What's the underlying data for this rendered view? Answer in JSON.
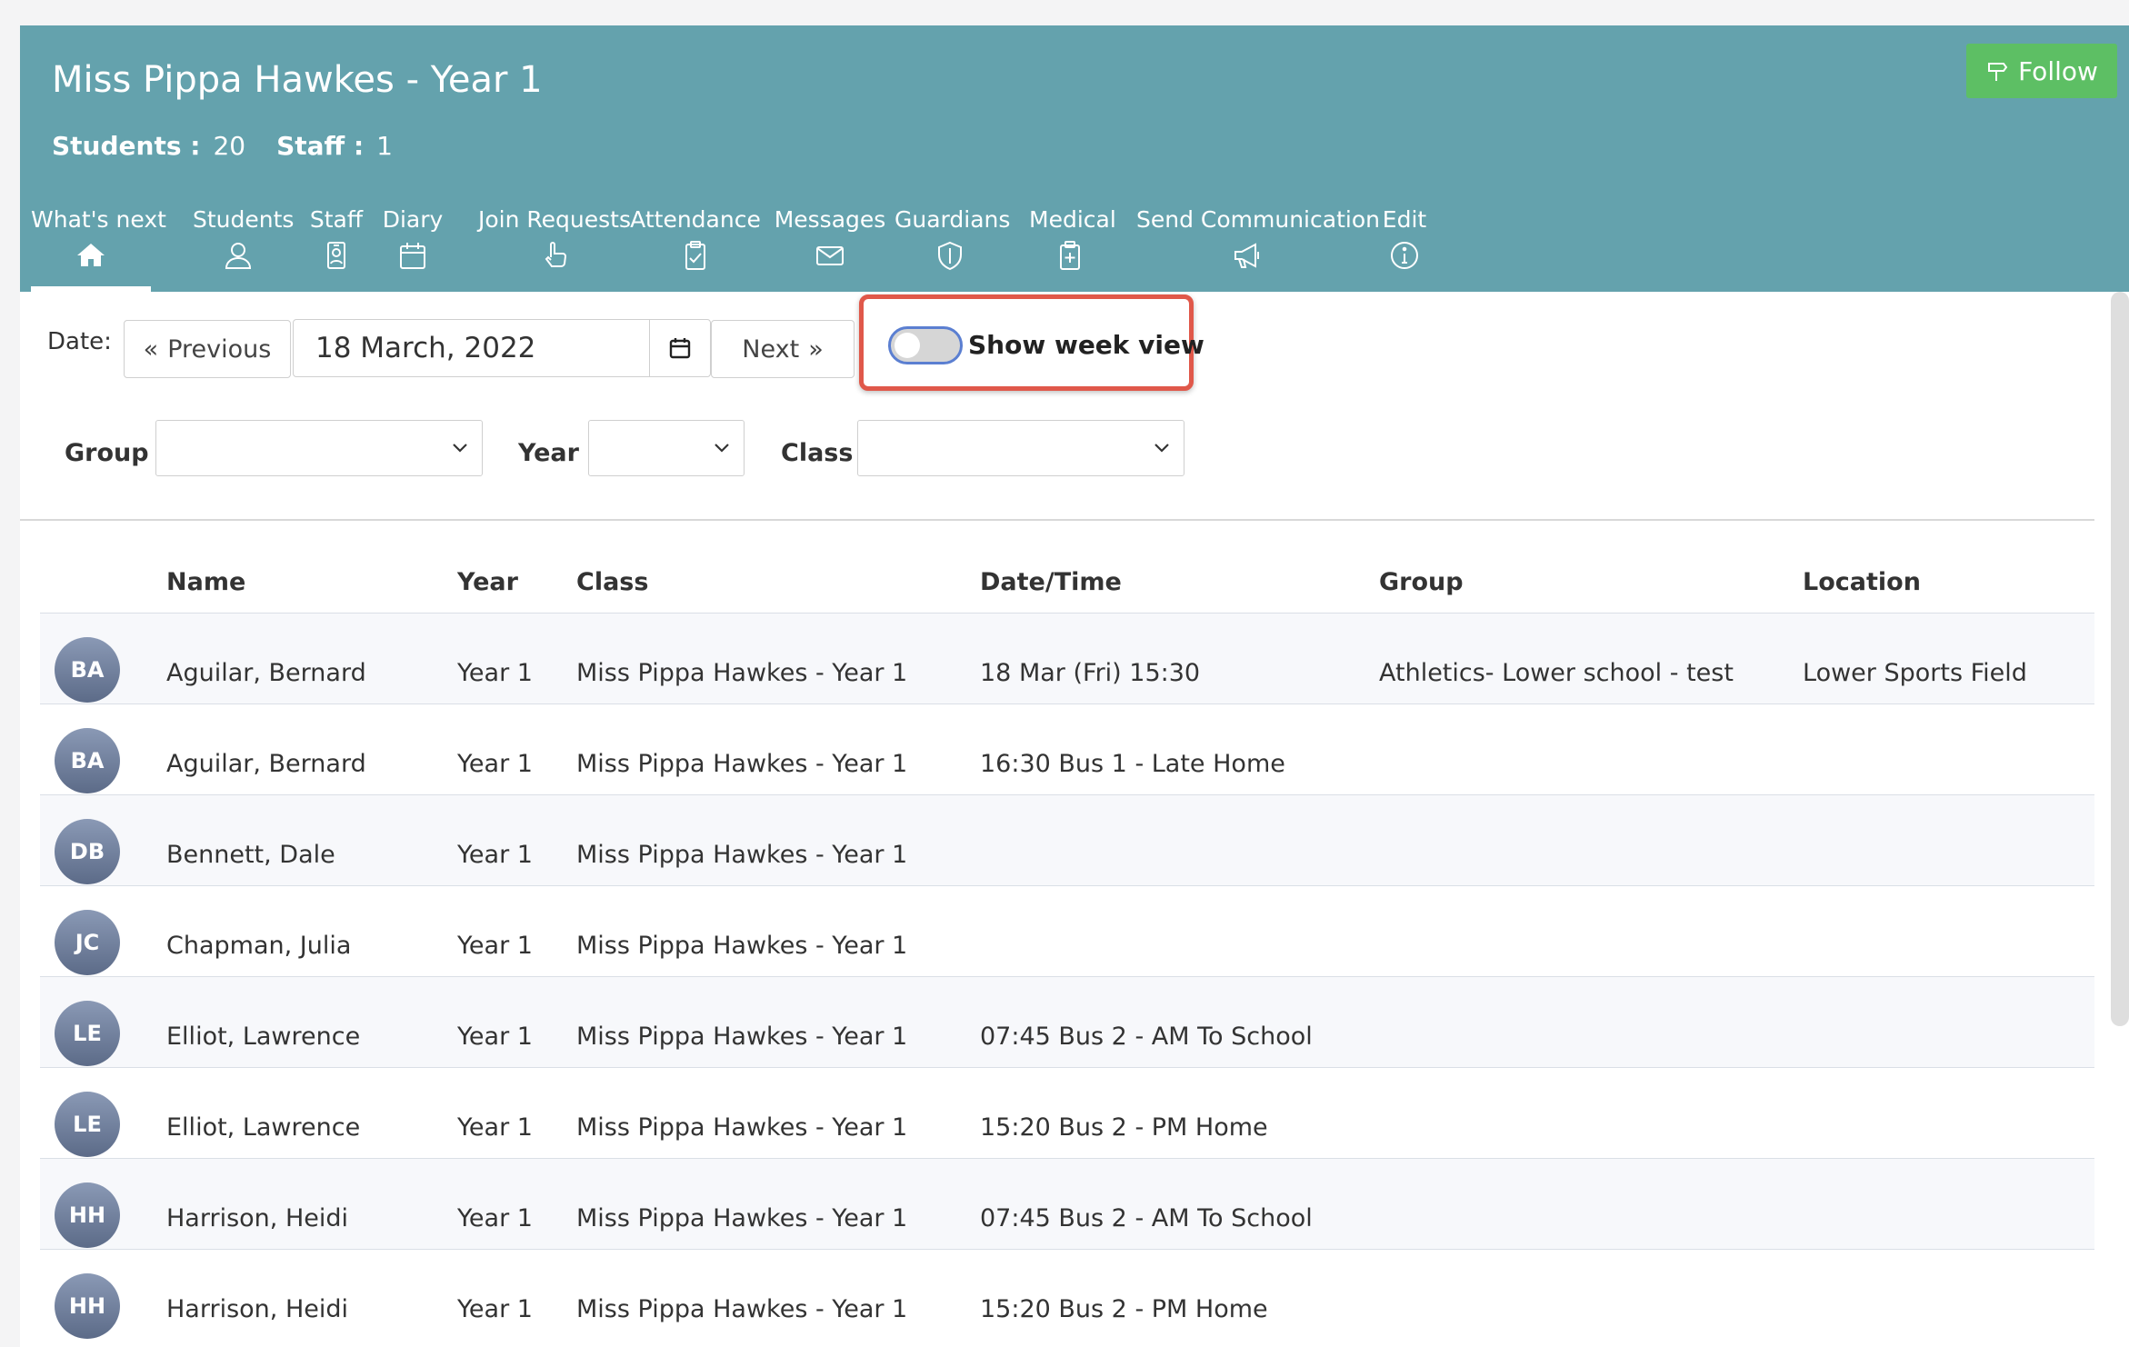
{
  "header": {
    "title": "Miss Pippa Hawkes - Year 1",
    "students_label": "Students :",
    "students_count": "20",
    "staff_label": "Staff :",
    "staff_count": "1",
    "follow_label": "Follow"
  },
  "nav": {
    "tabs": [
      {
        "label": "What's next",
        "icon": "home-icon"
      },
      {
        "label": "Students",
        "icon": "person-icon"
      },
      {
        "label": "Staff",
        "icon": "id-badge-icon"
      },
      {
        "label": "Diary",
        "icon": "calendar-icon"
      },
      {
        "label": "Join Requests",
        "icon": "hand-pointer-icon"
      },
      {
        "label": "Attendance",
        "icon": "clipboard-check-icon"
      },
      {
        "label": "Messages",
        "icon": "envelope-icon"
      },
      {
        "label": "Guardians",
        "icon": "shield-icon"
      },
      {
        "label": "Medical",
        "icon": "medical-kit-icon"
      },
      {
        "label": "Send Communication",
        "icon": "megaphone-icon"
      },
      {
        "label": "Edit",
        "icon": "info-circle-icon"
      }
    ],
    "active_tab": "What's next"
  },
  "date_bar": {
    "label": "Date:",
    "previous_label": "Previous",
    "date_value": "18 March, 2022",
    "next_label": "Next",
    "toggle_label": "Show week view",
    "toggle_on": false
  },
  "filters": {
    "group_label": "Group",
    "year_label": "Year",
    "class_label": "Class",
    "group_value": "",
    "year_value": "",
    "class_value": ""
  },
  "table": {
    "columns": [
      "Name",
      "Year",
      "Class",
      "Date/Time",
      "Group",
      "Location"
    ],
    "rows": [
      {
        "initials": "BA",
        "name": "Aguilar, Bernard",
        "year": "Year 1",
        "class": "Miss Pippa Hawkes - Year 1",
        "datetime": "18 Mar (Fri) 15:30",
        "group": "Athletics- Lower school - test",
        "location": "Lower Sports Field"
      },
      {
        "initials": "BA",
        "name": "Aguilar, Bernard",
        "year": "Year 1",
        "class": "Miss Pippa Hawkes - Year 1",
        "datetime": "16:30 Bus 1 - Late Home",
        "group": "",
        "location": ""
      },
      {
        "initials": "DB",
        "name": "Bennett, Dale",
        "year": "Year 1",
        "class": "Miss Pippa Hawkes - Year 1",
        "datetime": "",
        "group": "",
        "location": ""
      },
      {
        "initials": "JC",
        "name": "Chapman, Julia",
        "year": "Year 1",
        "class": "Miss Pippa Hawkes - Year 1",
        "datetime": "",
        "group": "",
        "location": ""
      },
      {
        "initials": "LE",
        "name": "Elliot, Lawrence",
        "year": "Year 1",
        "class": "Miss Pippa Hawkes - Year 1",
        "datetime": "07:45 Bus 2 - AM To School",
        "group": "",
        "location": ""
      },
      {
        "initials": "LE",
        "name": "Elliot, Lawrence",
        "year": "Year 1",
        "class": "Miss Pippa Hawkes - Year 1",
        "datetime": "15:20 Bus 2 - PM Home",
        "group": "",
        "location": ""
      },
      {
        "initials": "HH",
        "name": "Harrison, Heidi",
        "year": "Year 1",
        "class": "Miss Pippa Hawkes - Year 1",
        "datetime": "07:45 Bus 2 - AM To School",
        "group": "",
        "location": ""
      },
      {
        "initials": "HH",
        "name": "Harrison, Heidi",
        "year": "Year 1",
        "class": "Miss Pippa Hawkes - Year 1",
        "datetime": "15:20 Bus 2 - PM Home",
        "group": "",
        "location": ""
      }
    ]
  },
  "colors": {
    "header_bg": "#64a2ad",
    "follow_bg": "#5dbf64",
    "highlight_border": "#e0584a",
    "avatar": "#6d7c99"
  }
}
